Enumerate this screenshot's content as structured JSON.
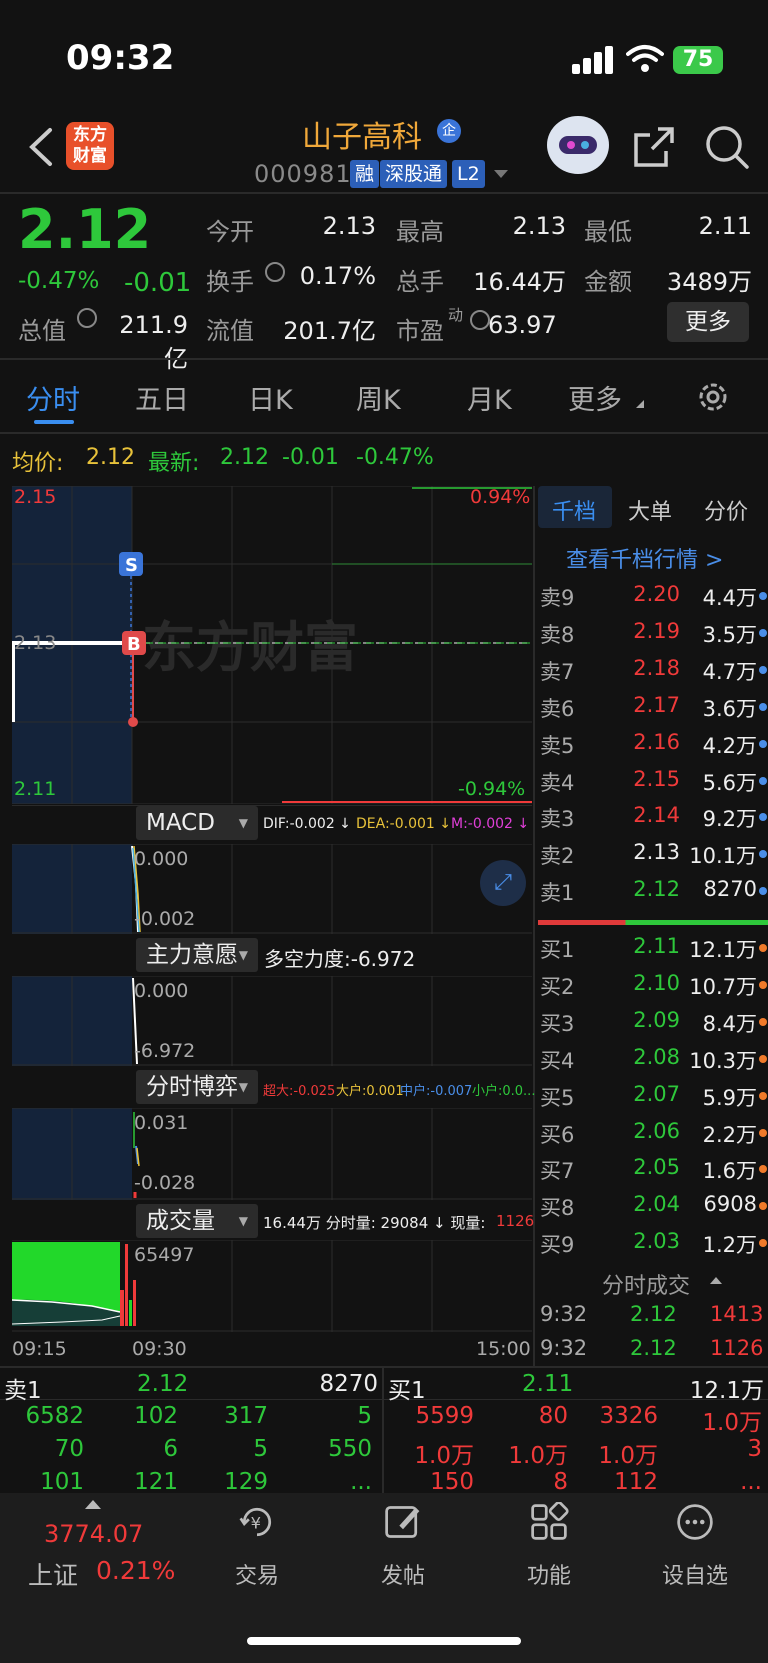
{
  "status_bar": {
    "time": "09:32",
    "battery": "75"
  },
  "header": {
    "logo_text": "东方财富",
    "stock_name": "山子高科",
    "enterprise_badge": "企",
    "stock_code": "000981",
    "tags": [
      "融",
      "深股通",
      "L2"
    ]
  },
  "quote": {
    "price": "2.12",
    "change_pct": "-0.47%",
    "change": "-0.01",
    "fields": {
      "open": {
        "label": "今开",
        "value": "2.13"
      },
      "high": {
        "label": "最高",
        "value": "2.13"
      },
      "low": {
        "label": "最低",
        "value": "2.11"
      },
      "turnover_rate": {
        "label": "换手",
        "value": "0.17%"
      },
      "volume": {
        "label": "总手",
        "value": "16.44万"
      },
      "amount": {
        "label": "金额",
        "value": "3489万"
      },
      "market_cap": {
        "label": "总值",
        "value": "211.9亿"
      },
      "float_cap": {
        "label": "流值",
        "value": "201.7亿"
      },
      "pe": {
        "label": "市盈",
        "sup": "动",
        "value": "63.97"
      }
    },
    "more_button": "更多"
  },
  "tabs": [
    "分时",
    "五日",
    "日K",
    "周K",
    "月K",
    "更多"
  ],
  "chart_info": {
    "avg_label": "均价:",
    "avg_value": "2.12",
    "latest_label": "最新:",
    "latest_value": "2.12",
    "latest_change": "-0.01",
    "latest_pct": "-0.47%"
  },
  "chart_data": {
    "type": "line",
    "y_ticks": [
      "2.15",
      "2.13",
      "2.11"
    ],
    "pct_ticks": [
      "0.94%",
      "-0.94%"
    ],
    "x_ticks": [
      "09:15",
      "09:30",
      "15:00"
    ],
    "ylim": [
      2.11,
      2.15
    ],
    "series": [
      {
        "x": [
          "09:15",
          "09:30"
        ],
        "values": [
          2.13,
          2.13
        ]
      }
    ],
    "markers": [
      "S",
      "B"
    ],
    "watermark": "东方财富"
  },
  "side_tabs": [
    "千档",
    "大单",
    "分价"
  ],
  "view_depth": "查看千档行情 >",
  "asks": [
    {
      "label": "卖9",
      "price": "2.20",
      "vol": "4.4万"
    },
    {
      "label": "卖8",
      "price": "2.19",
      "vol": "3.5万"
    },
    {
      "label": "卖7",
      "price": "2.18",
      "vol": "4.7万"
    },
    {
      "label": "卖6",
      "price": "2.17",
      "vol": "3.6万"
    },
    {
      "label": "卖5",
      "price": "2.16",
      "vol": "4.2万"
    },
    {
      "label": "卖4",
      "price": "2.15",
      "vol": "5.6万"
    },
    {
      "label": "卖3",
      "price": "2.14",
      "vol": "9.2万"
    },
    {
      "label": "卖2",
      "price": "2.13",
      "vol": "10.1万"
    },
    {
      "label": "卖1",
      "price": "2.12",
      "vol": "8270"
    }
  ],
  "bids": [
    {
      "label": "买1",
      "price": "2.11",
      "vol": "12.1万"
    },
    {
      "label": "买2",
      "price": "2.10",
      "vol": "10.7万"
    },
    {
      "label": "买3",
      "price": "2.09",
      "vol": "8.4万"
    },
    {
      "label": "买4",
      "price": "2.08",
      "vol": "10.3万"
    },
    {
      "label": "买5",
      "price": "2.07",
      "vol": "5.9万"
    },
    {
      "label": "买6",
      "price": "2.06",
      "vol": "2.2万"
    },
    {
      "label": "买7",
      "price": "2.05",
      "vol": "1.6万"
    },
    {
      "label": "买8",
      "price": "2.04",
      "vol": "6908"
    },
    {
      "label": "买9",
      "price": "2.03",
      "vol": "1.2万"
    }
  ],
  "tick_trades": {
    "title": "分时成交",
    "rows": [
      {
        "time": "9:32",
        "price": "2.12",
        "vol": "1413"
      },
      {
        "time": "9:32",
        "price": "2.12",
        "vol": "1126"
      }
    ]
  },
  "indicators": {
    "macd": {
      "name": "MACD",
      "dif": "DIF:-0.002 ↓",
      "dea": "DEA:-0.001 ↓",
      "m": "M:-0.002 ↓",
      "top": "0.000",
      "bottom": "-0.002"
    },
    "main": {
      "name": "主力意愿",
      "text": "多空力度:-6.972",
      "top": "0.000",
      "bottom": "-6.972"
    },
    "game": {
      "name": "分时博弈",
      "super": "超大:-0.025",
      "big": "大户:0.001",
      "mid": "中户:-0.007",
      "small": "小户:0.0...",
      "top": "0.031",
      "bottom": "-0.028"
    },
    "volume": {
      "name": "成交量",
      "text1": "16.44万 分时量: 29084 ↓ 现量:",
      "now": "1126",
      "top": "65497"
    }
  },
  "bottom_level": {
    "sell": {
      "label": "卖1",
      "price": "2.12",
      "vol": "8270"
    },
    "buy": {
      "label": "买1",
      "price": "2.11",
      "vol": "12.1万"
    },
    "sell_queue": [
      [
        "6582",
        "102",
        "317",
        "5"
      ],
      [
        "70",
        "6",
        "5",
        "550"
      ],
      [
        "101",
        "121",
        "129",
        "..."
      ]
    ],
    "buy_queue": [
      [
        "5599",
        "80",
        "3326",
        "1.0万"
      ],
      [
        "1.0万",
        "1.0万",
        "1.0万",
        "3"
      ],
      [
        "150",
        "8",
        "112",
        "..."
      ]
    ]
  },
  "bottom_nav": {
    "index_value": "3774.07",
    "index_name": "上证",
    "index_pct": "0.21%",
    "items": [
      "交易",
      "发帖",
      "功能",
      "设自选"
    ]
  }
}
